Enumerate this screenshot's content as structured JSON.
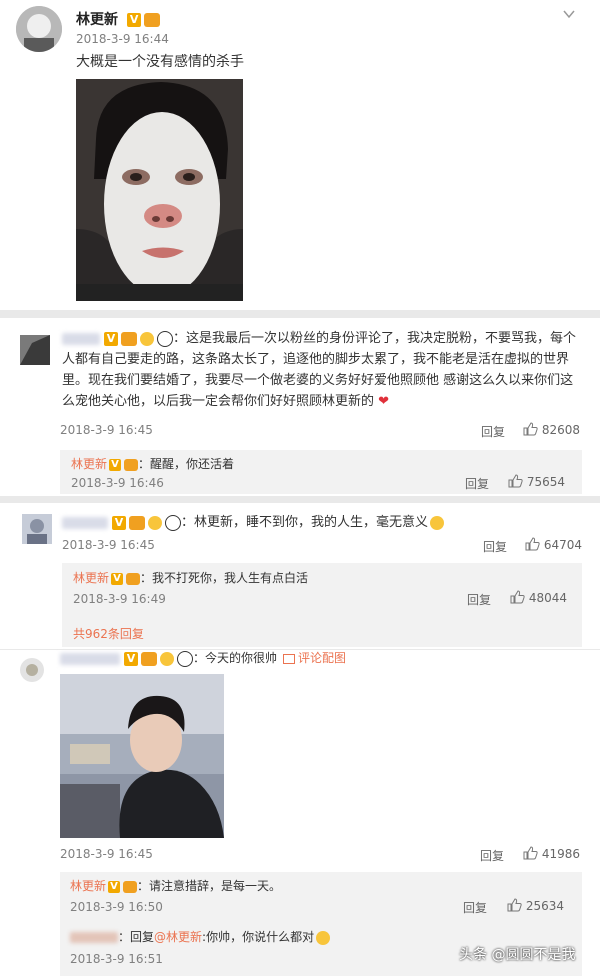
{
  "post": {
    "author": "林更新",
    "time": "2018-3-9 16:44",
    "text": "大概是一个没有感情的杀手"
  },
  "comments": [
    {
      "author": "",
      "time": "2018-3-9 16:45",
      "text": "：这是我最后一次以粉丝的身份评论了，我决定脱粉，不要骂我，每个人都有自己要走的路，这条路太长了，追逐他的脚步太累了，我不能老是活在虚拟的世界里。现在我们要结婚了，我要尽一个做老婆的义务好好爱他照顾他 感谢这么久以来你们这么宠他关心他，以后我一定会帮你们好好照顾林更新的",
      "reply_label": "回复",
      "likes": "82608",
      "reply": {
        "author": "林更新",
        "text": "：醒醒，你还活着",
        "time": "2018-3-9 16:46",
        "reply_label": "回复",
        "likes": "75654"
      }
    },
    {
      "author": "",
      "time": "2018-3-9 16:45",
      "text": "：林更新，睡不到你，我的人生，毫无意义",
      "reply_label": "回复",
      "likes": "64704",
      "reply": {
        "author": "林更新",
        "text": "：我不打死你，我人生有点白活",
        "time": "2018-3-9 16:49",
        "reply_label": "回复",
        "likes": "48044"
      },
      "more_replies": "共962条回复"
    },
    {
      "author": "",
      "text": "：今天的你很帅",
      "pic_link": "评论配图",
      "time": "2018-3-9 16:45",
      "reply_label": "回复",
      "likes": "41986",
      "reply": {
        "author": "林更新",
        "text": "：请注意措辞，是每一天。",
        "time": "2018-3-9 16:50",
        "reply_label": "回复",
        "likes": "25634"
      },
      "reply2": {
        "prefix": "：回复",
        "mention": "@林更新",
        "text": ":你帅，你说什么都对",
        "time": "2018-3-9 16:51"
      }
    }
  ],
  "watermark": "头条 @圆圆不是我"
}
